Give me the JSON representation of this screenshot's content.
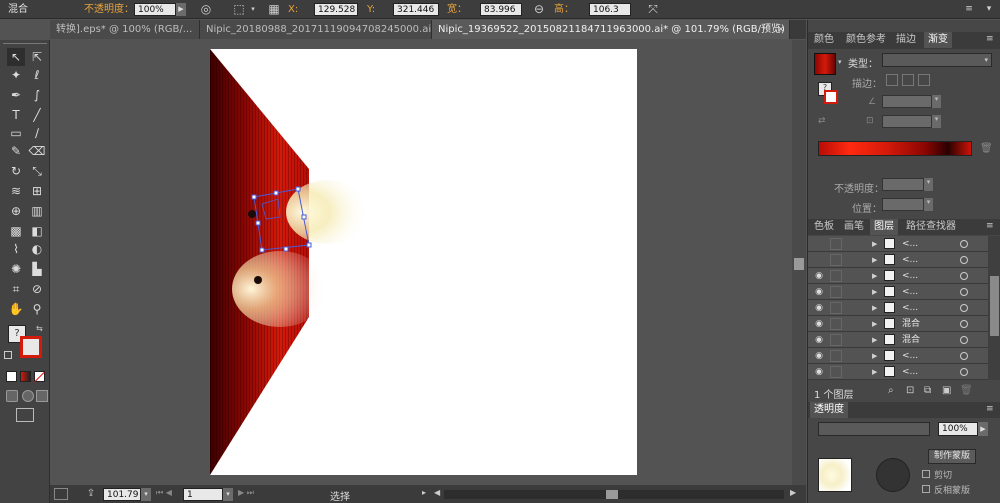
{
  "control_bar": {
    "mode_label": "混合",
    "opacity_label": "不透明度：",
    "opacity_value": "100%",
    "x_label": "X:",
    "x_value": "129.528 px",
    "y_label": "Y:",
    "y_value": "321.446 px",
    "width_label": "宽：",
    "width_value": "83.996 px",
    "height_label": "高：",
    "height_value": "106.3 px"
  },
  "tabs": [
    {
      "label": "转换].eps* @ 100% (RGB/...",
      "active": false
    },
    {
      "label": "Nipic_20180988_20171119094708245000.ai*",
      "active": false
    },
    {
      "label": "Nipic_19369522_20150821184711963000.ai* @ 101.79% (RGB/预览)",
      "active": true
    }
  ],
  "status_bar": {
    "zoom": "101.79",
    "page": "1",
    "tool_status": "选择"
  },
  "gradient_panel": {
    "tabs": [
      "颜色",
      "颜色参考",
      "描边",
      "渐变"
    ],
    "type_label": "类型：",
    "stroke_label": "描边：",
    "opacity_label": "不透明度：",
    "position_label": "位置："
  },
  "layers_panel": {
    "tabs": [
      "色板",
      "画笔",
      "图层",
      "路径查找器"
    ],
    "rows": [
      {
        "name": "<...",
        "visible": false
      },
      {
        "name": "<...",
        "visible": false
      },
      {
        "name": "<...",
        "visible": true
      },
      {
        "name": "<...",
        "visible": true
      },
      {
        "name": "<...",
        "visible": true
      },
      {
        "name": "混合",
        "visible": true
      },
      {
        "name": "混合",
        "visible": true
      },
      {
        "name": "<...",
        "visible": true
      },
      {
        "name": "<...",
        "visible": true
      }
    ],
    "footer_label": "1 个图层"
  },
  "transparency_panel": {
    "tab_label": "透明度",
    "opacity_value": "100%",
    "make_mask_button": "制作蒙版",
    "clip_label": "剪切",
    "invert_label": "反相蒙版"
  },
  "colors": {
    "accent_red": "#d41a0a",
    "selection_blue": "#4a5ad8"
  }
}
